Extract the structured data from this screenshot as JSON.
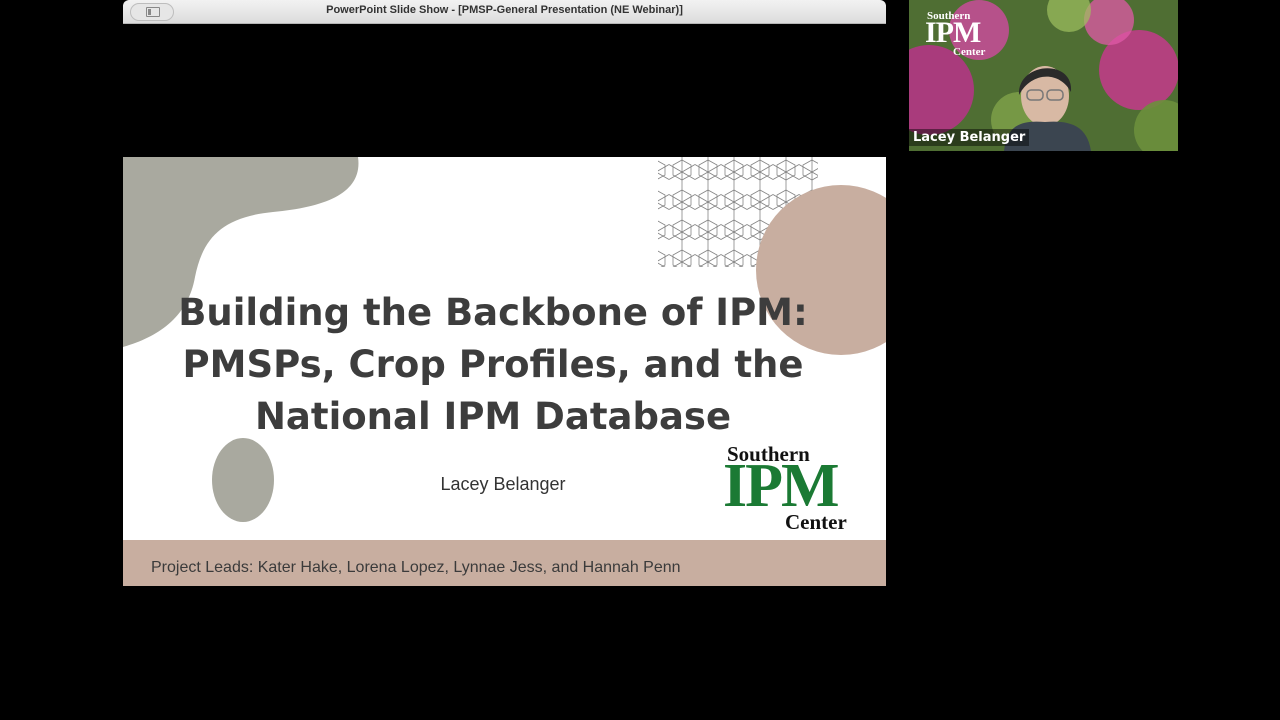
{
  "window": {
    "title": "PowerPoint Slide Show - [PMSP-General Presentation (NE Webinar)]"
  },
  "slide": {
    "title_lines": [
      "Building the Backbone of IPM:",
      "PMSPs, Crop Profiles, and the",
      "National IPM Database"
    ],
    "presenter": "Lacey Belanger",
    "footer": "Project Leads: Kater Hake, Lorena Lopez, Lynnae Jess, and Hannah Penn",
    "logo": {
      "top": "Southern",
      "middle": "IPM",
      "bottom": "Center"
    },
    "colors": {
      "accent_tan": "#c8aea0",
      "blob_gray": "#a9a99f",
      "logo_green": "#1b7a34",
      "title_text": "#3d3d3d"
    }
  },
  "video": {
    "participant_name": "Lacey Belanger",
    "background_logo": {
      "top": "Southern",
      "middle": "IPM",
      "bottom": "Center"
    }
  }
}
